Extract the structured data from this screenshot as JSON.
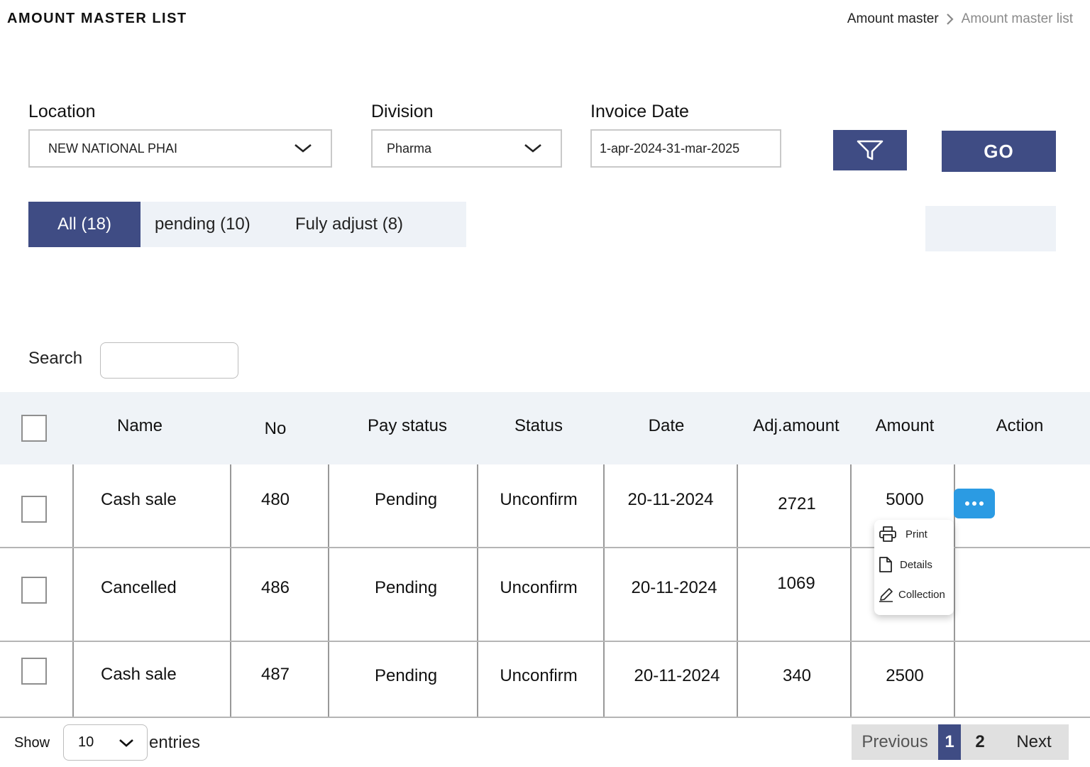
{
  "header": {
    "title": "AMOUNT MASTER LIST",
    "breadcrumb": [
      "Amount master",
      "Amount master list"
    ]
  },
  "filters": {
    "location": {
      "label": "Location",
      "value": "NEW NATIONAL PHAI"
    },
    "division": {
      "label": "Division",
      "value": "Pharma"
    },
    "invoice_date": {
      "label": "Invoice Date",
      "value": "1-apr-2024-31-mar-2025"
    },
    "go_label": "GO"
  },
  "tabs": [
    {
      "label": "All (18)",
      "active": true
    },
    {
      "label": "pending (10)",
      "active": false
    },
    {
      "label": "Fuly adjust (8)",
      "active": false
    }
  ],
  "search": {
    "label": "Search",
    "value": ""
  },
  "table": {
    "columns": [
      "Name",
      "No",
      "Pay status",
      "Status",
      "Date",
      "Adj.amount",
      "Amount",
      "Action"
    ],
    "rows": [
      {
        "name": "Cash sale",
        "no": "480",
        "pay_status": "Pending",
        "status": "Unconfirm",
        "date": "20-11-2024",
        "adj_amount": "2721",
        "amount": "5000"
      },
      {
        "name": "Cancelled",
        "no": "486",
        "pay_status": "Pending",
        "status": "Unconfirm",
        "date": "20-11-2024",
        "adj_amount": "1069",
        "amount": ""
      },
      {
        "name": "Cash sale",
        "no": "487",
        "pay_status": "Pending",
        "status": "Unconfirm",
        "date": "20-11-2024",
        "adj_amount": "340",
        "amount": "2500"
      }
    ]
  },
  "action_menu": {
    "items": [
      {
        "label": "Print",
        "icon": "printer-icon"
      },
      {
        "label": "Details",
        "icon": "document-icon"
      },
      {
        "label": "Collection",
        "icon": "pencil-icon"
      }
    ]
  },
  "footer": {
    "show_label": "Show",
    "entries_value": "10",
    "entries_label": "entries",
    "pagination": {
      "previous": "Previous",
      "pages": [
        "1",
        "2"
      ],
      "current": "1",
      "next": "Next"
    }
  },
  "colors": {
    "primary": "#3f4c84",
    "accent_button": "#2b9be3",
    "header_bg": "#eff3f7"
  }
}
